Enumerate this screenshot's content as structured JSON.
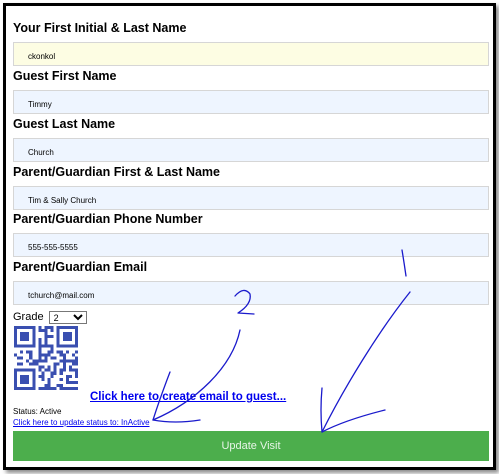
{
  "form": {
    "fields": [
      {
        "label": "Your First Initial & Last Name",
        "value": "ckonkol"
      },
      {
        "label": "Guest First Name",
        "value": "Timmy"
      },
      {
        "label": "Guest Last Name",
        "value": "Church"
      },
      {
        "label": "Parent/Guardian First & Last Name",
        "value": "Tim & Sally Church"
      },
      {
        "label": "Parent/Guardian Phone Number",
        "value": "555-555-5555"
      },
      {
        "label": "Parent/Guardian Email",
        "value": "tchurch@mail.com"
      }
    ],
    "grade_label": "Grade",
    "grade_value": "2"
  },
  "email_link": "Click here to create email to guest...",
  "status": {
    "text": "Status: Active",
    "update_link": "Click here to update status to: InActive"
  },
  "update_button": "Update Visit",
  "annotations": {
    "number_1": "1",
    "number_2": "2"
  },
  "colors": {
    "field_bg": "#eef5ff",
    "first_field_bg": "#fdfde3",
    "button": "#4cae4c",
    "link": "#0000ee",
    "annotation": "#1a1acc"
  }
}
